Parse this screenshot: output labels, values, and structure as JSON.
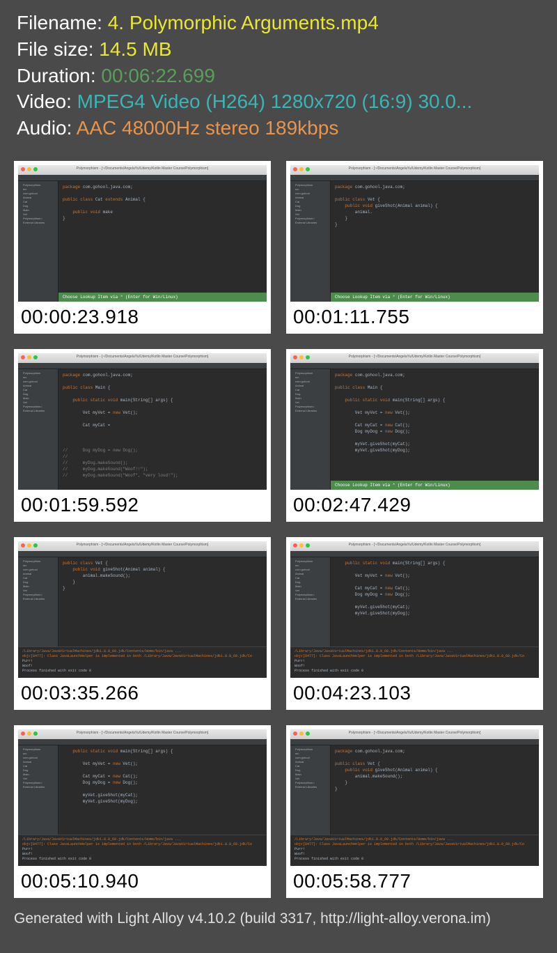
{
  "labels": {
    "filename": "Filename: ",
    "filesize": "File size: ",
    "duration": "Duration: ",
    "video": "Video: ",
    "audio": "Audio: "
  },
  "values": {
    "filename": "4. Polymorphic Arguments.mp4",
    "filesize": "14.5 MB",
    "duration": "00:06:22.699",
    "video": "MPEG4 Video (H264) 1280x720 (16:9) 30.0...",
    "audio": "AAC 48000Hz stereo 189kbps"
  },
  "hint": "Choose Lookup Item  via ⌃  (Enter for Win/Linux)",
  "ide_title": "Polymorphism - [~/Documents/AngelaYu/Udemy/Kotlin Master Course/Polymorphism]",
  "sidebar": [
    "Polymorphism",
    "  src",
    "    com.gohool",
    "      Animal",
    "      Cat",
    "      Dog",
    "      Main",
    "      Vet",
    "Polymorphism.i",
    "External Libraries"
  ],
  "console": {
    "path": "/Library/Java/JavaVirtualMachines/jdk1.8.0_60.jdk/Contents/Home/bin/java ...",
    "warn": "objc[8477]: Class JavaLaunchHelper is implemented in both /Library/Java/JavaVirtualMachines/jdk1.8.0_60.jdk/Co",
    "out1": "Purr!",
    "out2": "Woof!",
    "exit": "Process finished with exit code 0"
  },
  "frames": [
    {
      "ts": "00:00:23.918",
      "hint": true,
      "console": false,
      "code": [
        {
          "t": "package ",
          "c": "kw"
        },
        {
          "t": "com.gohool.java.com;\n\n",
          "c": ""
        },
        {
          "t": "public class ",
          "c": "kw"
        },
        {
          "t": "Cat ",
          "c": ""
        },
        {
          "t": "extends ",
          "c": "kw"
        },
        {
          "t": "Animal {\n\n",
          "c": ""
        },
        {
          "t": "    public void ",
          "c": "kw"
        },
        {
          "t": "make",
          "c": ""
        },
        {
          "t": "\n",
          "c": ""
        },
        {
          "t": "}",
          "c": ""
        }
      ]
    },
    {
      "ts": "00:01:11.755",
      "hint": true,
      "console": false,
      "code": [
        {
          "t": "package ",
          "c": "kw"
        },
        {
          "t": "com.gohool.java.com;\n\n",
          "c": ""
        },
        {
          "t": "public class ",
          "c": "kw"
        },
        {
          "t": "Vet {\n",
          "c": ""
        },
        {
          "t": "    public void ",
          "c": "kw"
        },
        {
          "t": "giveShot(Animal animal) {\n",
          "c": ""
        },
        {
          "t": "        animal.\n",
          "c": ""
        },
        {
          "t": "    }\n}",
          "c": ""
        }
      ]
    },
    {
      "ts": "00:01:59.592",
      "hint": false,
      "console": false,
      "code": [
        {
          "t": "package ",
          "c": "kw"
        },
        {
          "t": "com.gohool.java.com;\n\n",
          "c": ""
        },
        {
          "t": "public class ",
          "c": "kw"
        },
        {
          "t": "Main {\n\n",
          "c": ""
        },
        {
          "t": "    public static void ",
          "c": "kw"
        },
        {
          "t": "main(String[] args) {\n\n",
          "c": ""
        },
        {
          "t": "        Vet myVet = ",
          "c": ""
        },
        {
          "t": "new ",
          "c": "kw"
        },
        {
          "t": "Vet();\n\n",
          "c": ""
        },
        {
          "t": "        Cat myCat = \n\n\n\n",
          "c": ""
        },
        {
          "t": "//      Dog myDog = new Dog();\n",
          "c": "com"
        },
        {
          "t": "//\n",
          "c": "com"
        },
        {
          "t": "//      myDog.makeSound();\n",
          "c": "com"
        },
        {
          "t": "//      myDog.makeSound(\"Woof!!\");\n",
          "c": "com"
        },
        {
          "t": "//      myDog.makeSound(\"Woof\", \"very loud!\");",
          "c": "com"
        }
      ]
    },
    {
      "ts": "00:02:47.429",
      "hint": true,
      "console": false,
      "code": [
        {
          "t": "package ",
          "c": "kw"
        },
        {
          "t": "com.gohool.java.com;\n\n",
          "c": ""
        },
        {
          "t": "public class ",
          "c": "kw"
        },
        {
          "t": "Main {\n\n",
          "c": ""
        },
        {
          "t": "    public static void ",
          "c": "kw"
        },
        {
          "t": "main(String[] args) {\n\n",
          "c": ""
        },
        {
          "t": "        Vet myVet = ",
          "c": ""
        },
        {
          "t": "new ",
          "c": "kw"
        },
        {
          "t": "Vet();\n\n",
          "c": ""
        },
        {
          "t": "        Cat myCat = ",
          "c": ""
        },
        {
          "t": "new ",
          "c": "kw"
        },
        {
          "t": "Cat();\n",
          "c": ""
        },
        {
          "t": "        Dog myDog = ",
          "c": ""
        },
        {
          "t": "new ",
          "c": "kw"
        },
        {
          "t": "Dog();\n\n",
          "c": ""
        },
        {
          "t": "        myVet.giveShot(myCat);\n",
          "c": ""
        },
        {
          "t": "        myVet.giveShot(myDog);",
          "c": ""
        }
      ]
    },
    {
      "ts": "00:03:35.266",
      "hint": false,
      "console": true,
      "code": [
        {
          "t": "public class ",
          "c": "kw"
        },
        {
          "t": "Vet {\n",
          "c": ""
        },
        {
          "t": "    public void ",
          "c": "kw"
        },
        {
          "t": "giveShot(Animal animal) {\n",
          "c": ""
        },
        {
          "t": "        animal.makeSound();\n",
          "c": ""
        },
        {
          "t": "    }\n}",
          "c": ""
        }
      ]
    },
    {
      "ts": "00:04:23.103",
      "hint": false,
      "console": true,
      "code": [
        {
          "t": "    public static void ",
          "c": "kw"
        },
        {
          "t": "main(String[] args) {\n\n",
          "c": ""
        },
        {
          "t": "        Vet myVet = ",
          "c": ""
        },
        {
          "t": "new ",
          "c": "kw"
        },
        {
          "t": "Vet();\n\n",
          "c": ""
        },
        {
          "t": "        Cat myCat = ",
          "c": ""
        },
        {
          "t": "new ",
          "c": "kw"
        },
        {
          "t": "Cat();\n",
          "c": ""
        },
        {
          "t": "        Dog myDog = ",
          "c": ""
        },
        {
          "t": "new ",
          "c": "kw"
        },
        {
          "t": "Dog();\n\n",
          "c": ""
        },
        {
          "t": "        myVet.giveShot(myCat);\n",
          "c": ""
        },
        {
          "t": "        myVet.giveShot(myDog);",
          "c": ""
        }
      ]
    },
    {
      "ts": "00:05:10.940",
      "hint": false,
      "console": true,
      "code": [
        {
          "t": "    public static void ",
          "c": "kw"
        },
        {
          "t": "main(String[] args) {\n\n",
          "c": ""
        },
        {
          "t": "        Vet myVet = ",
          "c": ""
        },
        {
          "t": "new ",
          "c": "kw"
        },
        {
          "t": "Vet();\n\n",
          "c": ""
        },
        {
          "t": "        Cat myCat = ",
          "c": ""
        },
        {
          "t": "new ",
          "c": "kw"
        },
        {
          "t": "Cat();\n",
          "c": ""
        },
        {
          "t": "        Dog myDog = ",
          "c": ""
        },
        {
          "t": "new ",
          "c": "kw"
        },
        {
          "t": "Dog();\n\n",
          "c": ""
        },
        {
          "t": "        myVet.giveShot(myCat);\n",
          "c": ""
        },
        {
          "t": "        myVet.giveShot(myDog);",
          "c": ""
        }
      ]
    },
    {
      "ts": "00:05:58.777",
      "hint": false,
      "console": true,
      "code": [
        {
          "t": "package ",
          "c": "kw"
        },
        {
          "t": "com.gohool.java.com;\n\n",
          "c": ""
        },
        {
          "t": "public class ",
          "c": "kw"
        },
        {
          "t": "Vet {\n",
          "c": ""
        },
        {
          "t": "    public void ",
          "c": "kw"
        },
        {
          "t": "giveShot(Animal animal) {\n",
          "c": ""
        },
        {
          "t": "        animal.makeSound();\n",
          "c": ""
        },
        {
          "t": "    }\n}",
          "c": ""
        }
      ]
    }
  ],
  "footer": "Generated with Light Alloy v4.10.2 (build 3317, http://light-alloy.verona.im)"
}
